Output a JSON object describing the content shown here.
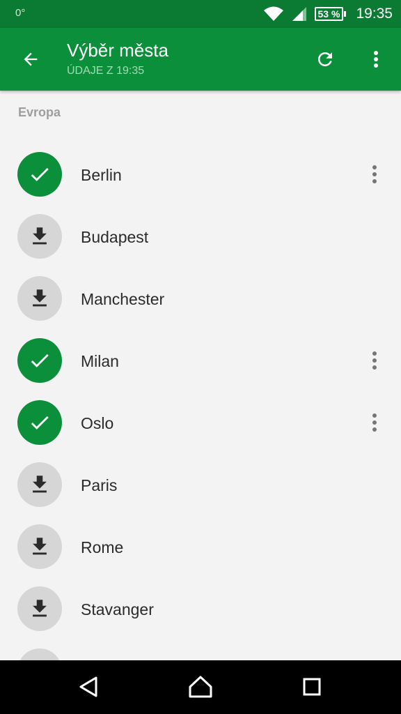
{
  "status_bar": {
    "temperature": "0°",
    "battery": "53 %",
    "time": "19:35"
  },
  "app_bar": {
    "title": "Výběr města",
    "subtitle": "ÚDAJE Z 19:35"
  },
  "section": {
    "header": "Evropa"
  },
  "cities": [
    {
      "name": "Berlin",
      "state": "downloaded",
      "icon": "check-icon",
      "has_menu": true
    },
    {
      "name": "Budapest",
      "state": "available",
      "icon": "download-icon",
      "has_menu": false
    },
    {
      "name": "Manchester",
      "state": "available",
      "icon": "download-icon",
      "has_menu": false
    },
    {
      "name": "Milan",
      "state": "downloaded",
      "icon": "check-icon",
      "has_menu": true
    },
    {
      "name": "Oslo",
      "state": "downloaded",
      "icon": "check-icon",
      "has_menu": true
    },
    {
      "name": "Paris",
      "state": "available",
      "icon": "download-icon",
      "has_menu": false
    },
    {
      "name": "Rome",
      "state": "available",
      "icon": "download-icon",
      "has_menu": false
    },
    {
      "name": "Stavanger",
      "state": "available",
      "icon": "download-icon",
      "has_menu": false
    },
    {
      "name": "",
      "state": "available",
      "icon": "download-icon",
      "has_menu": false
    }
  ],
  "colors": {
    "status_bar": "#0b7a32",
    "app_bar": "#0c8f3b",
    "downloaded_circle": "#0c8f3b",
    "available_circle": "#d6d6d6",
    "background": "#f3f3f3"
  }
}
